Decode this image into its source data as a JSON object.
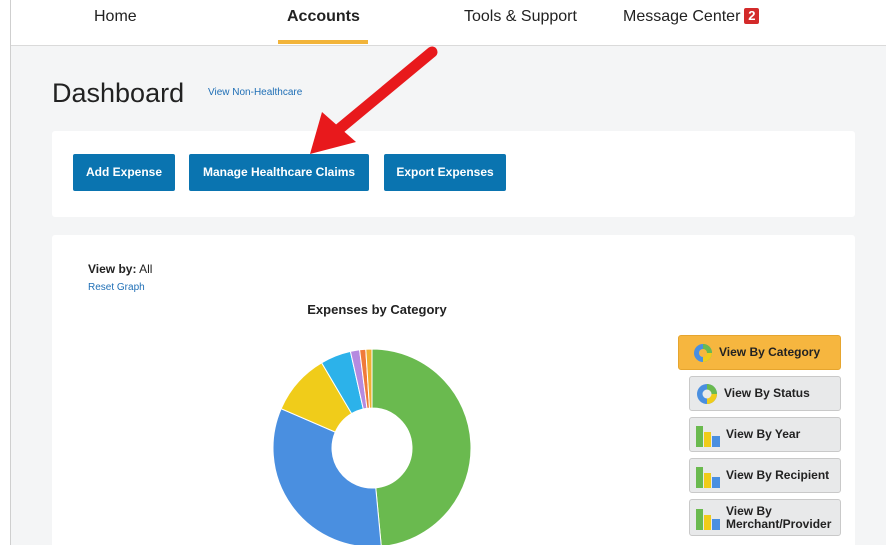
{
  "nav": {
    "home": "Home",
    "accounts": "Accounts",
    "tools": "Tools & Support",
    "messages": "Message Center",
    "message_count": "2"
  },
  "page": {
    "title": "Dashboard",
    "link": "View Non-Healthcare"
  },
  "actions": {
    "add_expense": "Add Expense",
    "manage_claims": "Manage Healthcare Claims",
    "export": "Export Expenses"
  },
  "chart_panel": {
    "view_by_label": "View by:",
    "view_by_value": "All",
    "reset": "Reset Graph",
    "view_buttons": [
      {
        "label": "View By Category",
        "icon": "donut-icon",
        "selected": true
      },
      {
        "label": "View By Status",
        "icon": "donut-icon",
        "selected": false
      },
      {
        "label": "View By Year",
        "icon": "bar-chart-icon",
        "selected": false
      },
      {
        "label": "View By Recipient",
        "icon": "bar-chart-icon",
        "selected": false
      },
      {
        "label": "View By Merchant/Provider",
        "icon": "bar-chart-icon",
        "selected": false
      }
    ]
  },
  "chart_data": {
    "type": "pie",
    "title": "Expenses by Category",
    "values": [
      48.5,
      33.0,
      10.0,
      5.0,
      1.5,
      1.0,
      1.0
    ],
    "colors": [
      "#6aba4f",
      "#4a8fe0",
      "#f0cc1a",
      "#2cb2ea",
      "#b58ae0",
      "#f07a3a",
      "#f0b030"
    ]
  },
  "colors": {
    "primary_button": "#0a74b0",
    "accent": "#f2b43a",
    "link": "#1f6fb6",
    "annotation_arrow": "#e8191c"
  }
}
